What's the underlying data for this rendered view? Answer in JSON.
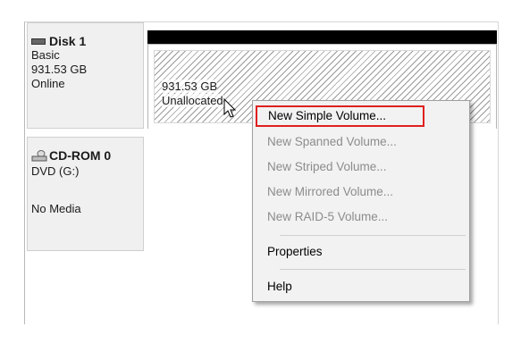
{
  "disk1": {
    "title": "Disk 1",
    "type": "Basic",
    "size": "931.53 GB",
    "status": "Online",
    "partition": {
      "size": "931.53 GB",
      "label": "Unallocated"
    }
  },
  "cdrom": {
    "title": "CD-ROM 0",
    "drive": "DVD (G:)",
    "media": "No Media"
  },
  "context_menu": {
    "items": [
      {
        "label": "New Simple Volume...",
        "enabled": true
      },
      {
        "label": "New Spanned Volume...",
        "enabled": false
      },
      {
        "label": "New Striped Volume...",
        "enabled": false
      },
      {
        "label": "New Mirrored Volume...",
        "enabled": false
      },
      {
        "label": "New RAID-5 Volume...",
        "enabled": false
      },
      {
        "label": "Properties",
        "enabled": true
      },
      {
        "label": "Help",
        "enabled": true
      }
    ],
    "highlight_color": "#e0201e"
  },
  "colors": {
    "label_bg": "#f0f0f0",
    "disk_bar": "#000000",
    "disabled_text": "#8c8c8c"
  },
  "icons": [
    "disk-icon",
    "cd-rom-icon",
    "mouse-pointer-icon"
  ]
}
